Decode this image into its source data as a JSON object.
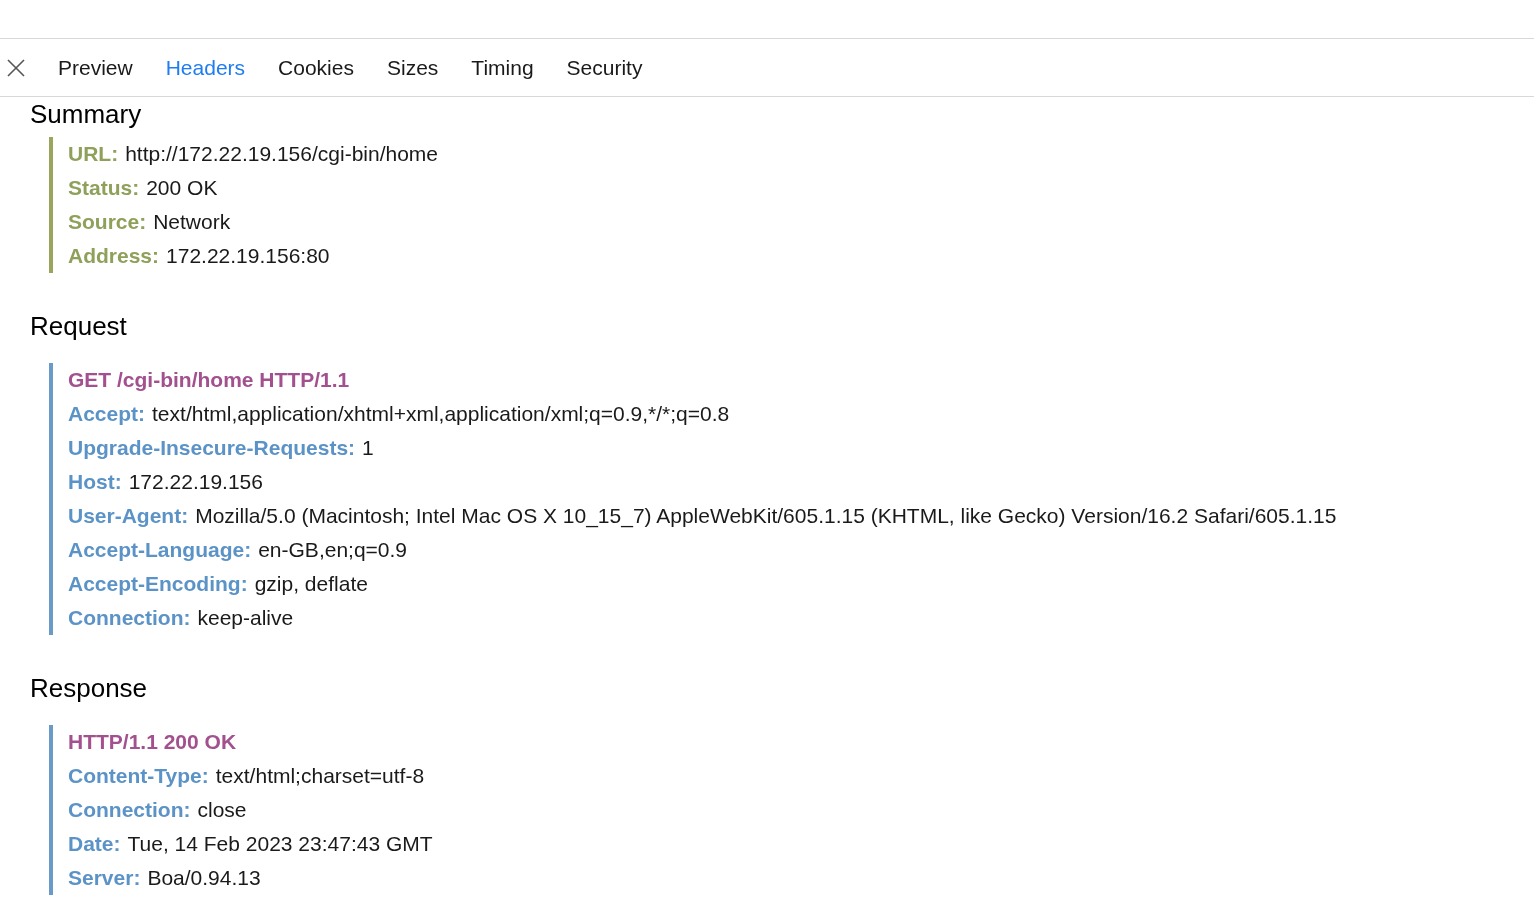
{
  "tabs": [
    {
      "label": "Preview",
      "selected": false
    },
    {
      "label": "Headers",
      "selected": true
    },
    {
      "label": "Cookies",
      "selected": false
    },
    {
      "label": "Sizes",
      "selected": false
    },
    {
      "label": "Timing",
      "selected": false
    },
    {
      "label": "Security",
      "selected": false
    }
  ],
  "sections": [
    {
      "title": "Summary",
      "kind": "summary",
      "lines": [
        {
          "kind": "header",
          "key": "URL:",
          "value": "http://172.22.19.156/cgi-bin/home"
        },
        {
          "kind": "header",
          "key": "Status:",
          "value": "200 OK"
        },
        {
          "kind": "header",
          "key": "Source:",
          "value": "Network"
        },
        {
          "kind": "header",
          "key": "Address:",
          "value": "172.22.19.156:80"
        }
      ]
    },
    {
      "title": "Request",
      "kind": "request",
      "lines": [
        {
          "kind": "status-line",
          "text": "GET /cgi-bin/home HTTP/1.1"
        },
        {
          "kind": "header",
          "key": "Accept:",
          "value": "text/html,application/xhtml+xml,application/xml;q=0.9,*/*;q=0.8"
        },
        {
          "kind": "header",
          "key": "Upgrade-Insecure-Requests:",
          "value": "1"
        },
        {
          "kind": "header",
          "key": "Host:",
          "value": "172.22.19.156"
        },
        {
          "kind": "header",
          "key": "User-Agent:",
          "value": "Mozilla/5.0 (Macintosh; Intel Mac OS X 10_15_7) AppleWebKit/605.1.15 (KHTML, like Gecko) Version/16.2 Safari/605.1.15"
        },
        {
          "kind": "header",
          "key": "Accept-Language:",
          "value": "en-GB,en;q=0.9"
        },
        {
          "kind": "header",
          "key": "Accept-Encoding:",
          "value": "gzip, deflate"
        },
        {
          "kind": "header",
          "key": "Connection:",
          "value": "keep-alive"
        }
      ]
    },
    {
      "title": "Response",
      "kind": "response",
      "lines": [
        {
          "kind": "status-line",
          "text": "HTTP/1.1 200 OK"
        },
        {
          "kind": "header",
          "key": "Content-Type:",
          "value": "text/html;charset=utf-8"
        },
        {
          "kind": "header",
          "key": "Connection:",
          "value": "close"
        },
        {
          "kind": "header",
          "key": "Date:",
          "value": "Tue, 14 Feb 2023 23:47:43 GMT"
        },
        {
          "kind": "header",
          "key": "Server:",
          "value": "Boa/0.94.13"
        }
      ]
    }
  ]
}
